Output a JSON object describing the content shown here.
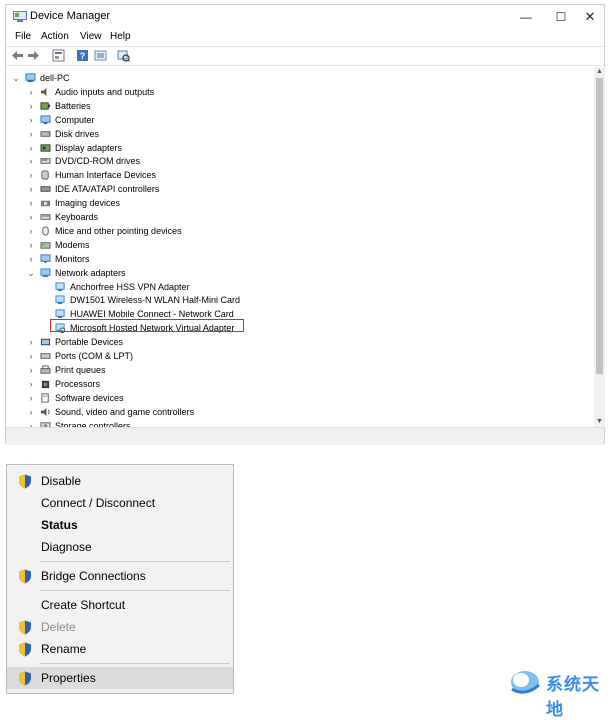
{
  "window": {
    "title": "Device Manager",
    "controls": {
      "minimize": "—",
      "maximize": "☐",
      "close": "✕"
    }
  },
  "menubar": [
    "File",
    "Action",
    "View",
    "Help"
  ],
  "toolbar": [
    "back",
    "forward",
    "properties-view",
    "help",
    "scan-hardware"
  ],
  "tree": {
    "root": "dell-PC",
    "categories": [
      {
        "label": "Audio inputs and outputs",
        "icon": "speaker-icon"
      },
      {
        "label": "Batteries",
        "icon": "battery-icon"
      },
      {
        "label": "Computer",
        "icon": "computer-icon"
      },
      {
        "label": "Disk drives",
        "icon": "disk-icon"
      },
      {
        "label": "Display adapters",
        "icon": "display-adapter-icon"
      },
      {
        "label": "DVD/CD-ROM drives",
        "icon": "dvd-icon"
      },
      {
        "label": "Human Interface Devices",
        "icon": "hid-icon"
      },
      {
        "label": "IDE ATA/ATAPI controllers",
        "icon": "ide-icon"
      },
      {
        "label": "Imaging devices",
        "icon": "camera-icon"
      },
      {
        "label": "Keyboards",
        "icon": "keyboard-icon"
      },
      {
        "label": "Mice and other pointing devices",
        "icon": "mouse-icon"
      },
      {
        "label": "Modems",
        "icon": "modem-icon"
      },
      {
        "label": "Monitors",
        "icon": "monitor-icon"
      },
      {
        "label": "Network adapters",
        "icon": "network-icon",
        "expanded": true
      }
    ],
    "network_children": [
      "Anchorfree HSS VPN Adapter",
      "DW1501 Wireless-N WLAN Half-Mini Card",
      "HUAWEI Mobile Connect - Network Card",
      "Microsoft Hosted Network Virtual Adapter"
    ],
    "categories_after": [
      {
        "label": "Portable Devices",
        "icon": "portable-icon"
      },
      {
        "label": "Ports (COM & LPT)",
        "icon": "port-icon"
      },
      {
        "label": "Print queues",
        "icon": "printer-icon"
      },
      {
        "label": "Processors",
        "icon": "processor-icon"
      },
      {
        "label": "Software devices",
        "icon": "software-icon"
      },
      {
        "label": "Sound, video and game controllers",
        "icon": "sound-icon"
      },
      {
        "label": "Storage controllers",
        "icon": "storage-icon"
      }
    ]
  },
  "context_menu": {
    "items": [
      {
        "label": "Disable",
        "shield": true
      },
      {
        "label": "Connect / Disconnect"
      },
      {
        "label": "Status",
        "bold": true
      },
      {
        "label": "Diagnose"
      },
      {
        "label": "Bridge Connections",
        "shield": true
      },
      {
        "label": "Create Shortcut"
      },
      {
        "label": "Delete",
        "shield": true,
        "disabled": true
      },
      {
        "label": "Rename",
        "shield": true
      },
      {
        "label": "Properties",
        "shield": true,
        "highlighted": true
      }
    ]
  },
  "watermark": {
    "text": "系统天地"
  },
  "colors": {
    "highlight_border": "#d9262b",
    "icon_blue": "#2b7fd6",
    "watermark": "#3a8ee6"
  }
}
